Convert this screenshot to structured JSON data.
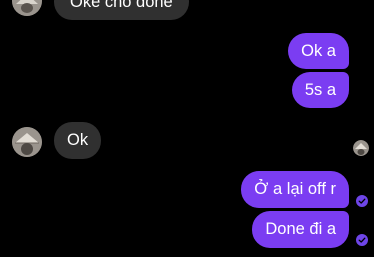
{
  "thread": {
    "messages": [
      {
        "sender": "contact",
        "text": "Oke cho done"
      },
      {
        "sender": "me",
        "text": "Ok a"
      },
      {
        "sender": "me",
        "text": "5s a"
      },
      {
        "sender": "contact",
        "text": "Ok"
      },
      {
        "sender": "me",
        "text": "Ở a lại off r"
      },
      {
        "sender": "me",
        "text": "Done đi a"
      }
    ],
    "read_status": [
      "seen",
      "seen"
    ]
  },
  "icons": {
    "contact_avatar": "contact-avatar-photo",
    "read_receipt_avatar": "read-receipt-avatar",
    "seen_check": "check-icon"
  },
  "colors": {
    "background": "#000000",
    "incoming_bubble": "#303030",
    "outgoing_bubble": "#7b3df2",
    "text": "#ffffff"
  }
}
